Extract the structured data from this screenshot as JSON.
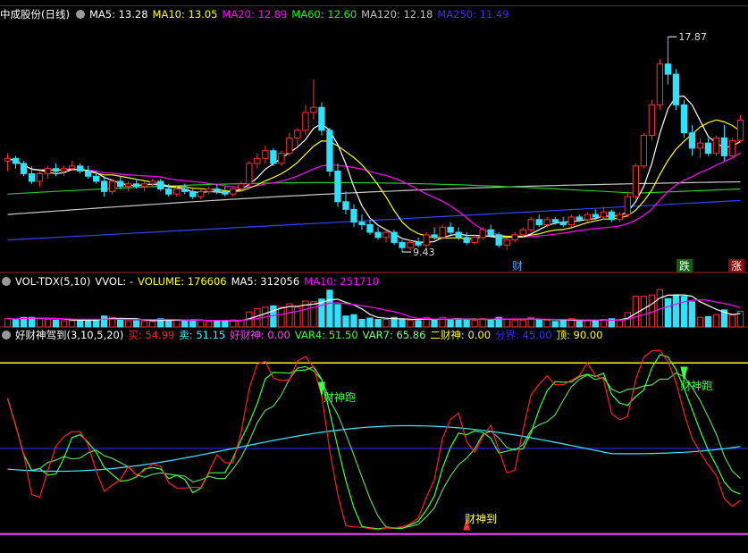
{
  "stock_name": "中成股份(日线)",
  "price_legend": [
    {
      "label": "MA5: 13.28",
      "color": "#ffffff"
    },
    {
      "label": "MA10: 13.05",
      "color": "#ffff00"
    },
    {
      "label": "MA20: 12.89",
      "color": "#ff00ff"
    },
    {
      "label": "MA60: 12.60",
      "color": "#00ff00"
    },
    {
      "label": "MA120: 12.18",
      "color": "#c0c0c0"
    },
    {
      "label": "MA250: 11.49",
      "color": "#3333ff"
    }
  ],
  "vol_title": "VOL-TDX(5,10)",
  "vol_legend": [
    {
      "label": "VVOL: -",
      "color": "#ffffff"
    },
    {
      "label": "VOLUME: 176606",
      "color": "#ffff00"
    },
    {
      "label": "MA5: 312056",
      "color": "#ffffff"
    },
    {
      "label": "MA10: 251710",
      "color": "#ff00ff"
    }
  ],
  "ind_title": "好财神驾到(3,10,5,20)",
  "ind_legend": [
    {
      "label": "买: 54.99",
      "color": "#ff2020"
    },
    {
      "label": "卖: 51.15",
      "color": "#40f0ff"
    },
    {
      "label": "好财神: 0.00",
      "color": "#ff40ff"
    },
    {
      "label": "VAR4: 51.50",
      "color": "#40ff40"
    },
    {
      "label": "VAR7: 65.86",
      "color": "#80ff80"
    },
    {
      "label": "二财神: 0.00",
      "color": "#ffff00"
    },
    {
      "label": "分界: 45.00",
      "color": "#3030ff"
    },
    {
      "label": "顶: 90.00",
      "color": "#ffff00"
    }
  ],
  "annotations": {
    "high_label": "17.87",
    "low_label": "9.43",
    "tag_cai": "财",
    "tag_die": "跌",
    "tag_zhang": "涨",
    "signal_run1": "财神跑",
    "signal_run2": "财神跑",
    "signal_arrive": "财神到"
  },
  "chart_data": {
    "type": "candlestick",
    "panels": [
      "price",
      "volume",
      "indicator"
    ],
    "price_range": [
      8.8,
      18.4
    ],
    "high": 17.87,
    "low": 9.43,
    "candles": [
      [
        13.0,
        13.3,
        12.6,
        13.1
      ],
      [
        13.1,
        13.2,
        12.7,
        12.9
      ],
      [
        12.9,
        13.0,
        12.4,
        12.5
      ],
      [
        12.5,
        12.8,
        12.1,
        12.2
      ],
      [
        12.2,
        12.6,
        12.0,
        12.5
      ],
      [
        12.5,
        12.8,
        12.3,
        12.7
      ],
      [
        12.7,
        12.9,
        12.4,
        12.6
      ],
      [
        12.6,
        12.8,
        12.4,
        12.7
      ],
      [
        12.7,
        13.0,
        12.6,
        12.8
      ],
      [
        12.8,
        12.9,
        12.5,
        12.6
      ],
      [
        12.6,
        12.8,
        12.3,
        12.4
      ],
      [
        12.4,
        12.6,
        12.1,
        12.2
      ],
      [
        12.2,
        12.4,
        11.6,
        11.8
      ],
      [
        11.8,
        12.3,
        11.7,
        12.2
      ],
      [
        12.2,
        12.4,
        11.9,
        12.0
      ],
      [
        12.0,
        12.2,
        11.8,
        12.1
      ],
      [
        12.1,
        12.3,
        11.9,
        12.0
      ],
      [
        12.0,
        12.2,
        11.8,
        12.1
      ],
      [
        12.1,
        12.3,
        12.0,
        12.2
      ],
      [
        12.2,
        12.3,
        11.8,
        11.9
      ],
      [
        11.9,
        12.1,
        11.6,
        11.7
      ],
      [
        11.7,
        12.0,
        11.6,
        11.9
      ],
      [
        11.9,
        12.1,
        11.7,
        11.8
      ],
      [
        11.8,
        11.9,
        11.5,
        11.6
      ],
      [
        11.6,
        11.9,
        11.5,
        11.8
      ],
      [
        11.8,
        12.0,
        11.7,
        11.9
      ],
      [
        11.9,
        12.1,
        11.7,
        11.8
      ],
      [
        11.8,
        12.0,
        11.6,
        11.7
      ],
      [
        11.7,
        12.0,
        11.6,
        11.9
      ],
      [
        11.9,
        12.2,
        11.8,
        12.1
      ],
      [
        12.1,
        13.0,
        12.0,
        12.9
      ],
      [
        12.9,
        13.3,
        12.7,
        13.1
      ],
      [
        13.1,
        13.6,
        12.9,
        13.4
      ],
      [
        13.4,
        13.5,
        12.8,
        12.9
      ],
      [
        12.9,
        13.4,
        12.8,
        13.3
      ],
      [
        13.3,
        14.1,
        13.2,
        13.9
      ],
      [
        13.9,
        14.3,
        13.6,
        14.2
      ],
      [
        14.2,
        15.2,
        14.0,
        14.9
      ],
      [
        14.9,
        16.2,
        14.6,
        15.1
      ],
      [
        15.1,
        15.3,
        14.0,
        14.2
      ],
      [
        14.2,
        14.3,
        12.4,
        12.6
      ],
      [
        12.6,
        12.9,
        11.2,
        11.4
      ],
      [
        11.4,
        11.8,
        10.9,
        11.1
      ],
      [
        11.1,
        11.3,
        10.4,
        10.6
      ],
      [
        10.6,
        10.9,
        10.3,
        10.5
      ],
      [
        10.5,
        10.7,
        10.1,
        10.2
      ],
      [
        10.2,
        10.4,
        9.9,
        10.0
      ],
      [
        10.0,
        10.3,
        9.8,
        10.2
      ],
      [
        10.2,
        10.3,
        9.7,
        9.8
      ],
      [
        9.8,
        9.9,
        9.43,
        9.6
      ],
      [
        9.6,
        9.9,
        9.5,
        9.8
      ],
      [
        9.8,
        10.0,
        9.6,
        9.7
      ],
      [
        9.7,
        10.2,
        9.6,
        10.1
      ],
      [
        10.1,
        10.4,
        9.9,
        10.0
      ],
      [
        10.0,
        10.5,
        9.9,
        10.4
      ],
      [
        10.4,
        10.6,
        10.1,
        10.2
      ],
      [
        10.2,
        10.4,
        9.9,
        10.0
      ],
      [
        10.0,
        10.2,
        9.7,
        9.8
      ],
      [
        9.8,
        10.1,
        9.7,
        10.0
      ],
      [
        10.0,
        10.4,
        9.9,
        10.3
      ],
      [
        10.3,
        10.5,
        10.0,
        10.1
      ],
      [
        10.1,
        10.2,
        9.6,
        9.7
      ],
      [
        9.7,
        10.0,
        9.5,
        9.9
      ],
      [
        9.9,
        10.2,
        9.8,
        10.1
      ],
      [
        10.1,
        10.4,
        10.0,
        10.3
      ],
      [
        10.3,
        10.8,
        10.2,
        10.7
      ],
      [
        10.7,
        10.9,
        10.4,
        10.5
      ],
      [
        10.5,
        10.8,
        10.4,
        10.7
      ],
      [
        10.7,
        10.8,
        10.5,
        10.6
      ],
      [
        10.6,
        10.8,
        10.4,
        10.5
      ],
      [
        10.5,
        10.9,
        10.4,
        10.8
      ],
      [
        10.8,
        10.9,
        10.6,
        10.7
      ],
      [
        10.7,
        11.0,
        10.6,
        10.9
      ],
      [
        10.9,
        11.1,
        10.7,
        10.8
      ],
      [
        10.8,
        11.2,
        10.7,
        11.0
      ],
      [
        11.0,
        11.1,
        10.6,
        10.7
      ],
      [
        10.7,
        11.0,
        10.6,
        10.9
      ],
      [
        10.9,
        11.8,
        10.8,
        11.6
      ],
      [
        11.6,
        12.9,
        11.5,
        12.8
      ],
      [
        12.8,
        14.1,
        12.7,
        14.0
      ],
      [
        14.0,
        15.4,
        13.8,
        15.2
      ],
      [
        15.2,
        17.0,
        15.0,
        16.8
      ],
      [
        16.8,
        17.87,
        16.0,
        16.4
      ],
      [
        16.4,
        16.6,
        15.0,
        15.2
      ],
      [
        15.2,
        15.4,
        13.9,
        14.1
      ],
      [
        14.1,
        14.4,
        13.2,
        13.5
      ],
      [
        13.5,
        13.9,
        13.1,
        13.7
      ],
      [
        13.7,
        13.9,
        13.2,
        13.3
      ],
      [
        13.3,
        14.0,
        13.2,
        13.9
      ],
      [
        13.9,
        14.4,
        13.0,
        13.2
      ],
      [
        13.2,
        13.9,
        13.1,
        13.8
      ],
      [
        13.8,
        14.8,
        13.7,
        14.6
      ]
    ],
    "ma_values": {
      "MA5": 13.28,
      "MA10": 13.05,
      "MA20": 12.89,
      "MA60": 12.6,
      "MA120": 12.18,
      "MA250": 11.49
    },
    "volume_values": {
      "VOLUME": 176606,
      "MA5": 312056,
      "MA10": 251710
    },
    "indicator_values": {
      "买": 54.99,
      "卖": 51.15,
      "好财神": 0.0,
      "VAR4": 51.5,
      "VAR7": 65.86,
      "二财神": 0.0,
      "分界": 45.0,
      "顶": 90.0
    },
    "indicator_range": [
      -10,
      100
    ]
  }
}
